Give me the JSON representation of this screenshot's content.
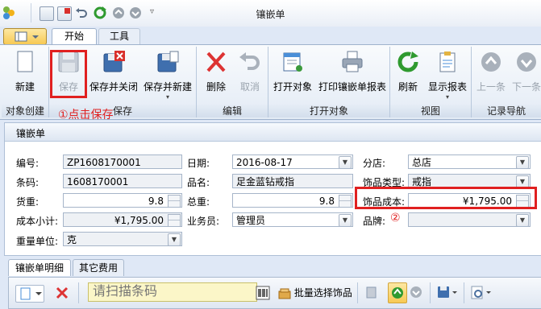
{
  "window": {
    "title": "镶嵌单"
  },
  "ribbon_tabs": [
    {
      "label": "开始"
    },
    {
      "label": "工具"
    }
  ],
  "ribbon": {
    "groups": [
      {
        "label": "对象创建"
      },
      {
        "label": "保存"
      },
      {
        "label": "编辑"
      },
      {
        "label": "打开对象"
      },
      {
        "label": "视图"
      },
      {
        "label": "记录导航"
      }
    ],
    "buttons": {
      "new": "新建",
      "save": "保存",
      "save_close": "保存并关闭",
      "save_new": "保存并新建",
      "delete": "删除",
      "cancel": "取消",
      "open_object": "打开对象",
      "print_report": "打印镶嵌单报表",
      "refresh": "刷新",
      "show_report": "显示报表",
      "prev": "上一条",
      "next": "下一条"
    }
  },
  "form": {
    "title": "镶嵌单",
    "fields": {
      "code_label": "编号:",
      "code_value": "ZP1608170001",
      "date_label": "日期:",
      "date_value": "2016-08-17",
      "store_label": "分店:",
      "store_value": "总店",
      "barcode_label": "条码:",
      "barcode_value": "1608170001",
      "name_label": "品名:",
      "name_value": "足金蓝钻戒指",
      "jewelry_type_label": "饰品类型:",
      "jewelry_type_value": "戒指",
      "goods_weight_label": "货重:",
      "goods_weight_value": "9.8",
      "total_weight_label": "总重:",
      "total_weight_value": "9.8",
      "jewelry_cost_label": "饰品成本:",
      "jewelry_cost_value": "¥1,795.00",
      "cost_subtotal_label": "成本小计:",
      "cost_subtotal_value": "¥1,795.00",
      "salesman_label": "业务员:",
      "salesman_value": "管理员",
      "brand_label": "品牌:",
      "brand_value": "",
      "weight_unit_label": "重量单位:",
      "weight_unit_value": "克"
    }
  },
  "detail_tabs": [
    {
      "label": "镶嵌单明细"
    },
    {
      "label": "其它费用"
    }
  ],
  "detail_toolbar": {
    "scan_placeholder": "请扫描条码",
    "batch_select_label": "批量选择饰品"
  },
  "annotations": {
    "step1": "①点击保存",
    "step2": "②"
  },
  "colors": {
    "annotation": "#e02020",
    "ribbon_bg": "#e3ebf5",
    "window_bg": "#dfe8f6"
  }
}
